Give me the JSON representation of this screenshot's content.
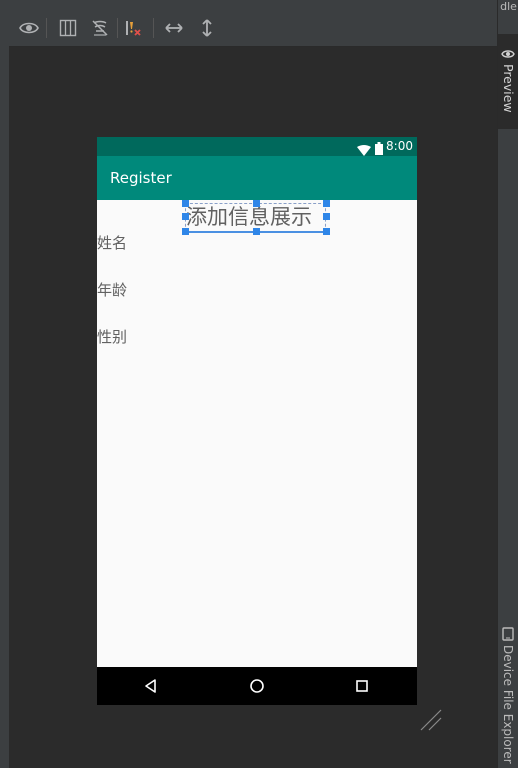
{
  "right_panel": {
    "top_label": "dle",
    "preview_tab": "Preview",
    "device_file_explorer_tab": "Device File Explorer"
  },
  "toolbar": {
    "icons": [
      "eye-icon",
      "split-view-icon",
      "blueprint-off-icon",
      "errors-icon",
      "expand-horizontal-icon",
      "expand-vertical-icon"
    ]
  },
  "device": {
    "status_time": "8:00",
    "app_title": "Register",
    "heading": "添加信息展示",
    "fields": [
      {
        "label": "姓名"
      },
      {
        "label": "年龄"
      },
      {
        "label": "性别"
      }
    ]
  },
  "colors": {
    "status_bar": "#00695c",
    "app_bar": "#00897b",
    "screen_bg": "#fafafa",
    "selection": "#2f86e8",
    "ide_bg": "#2b2b2b",
    "ide_panel": "#3c3f41"
  }
}
